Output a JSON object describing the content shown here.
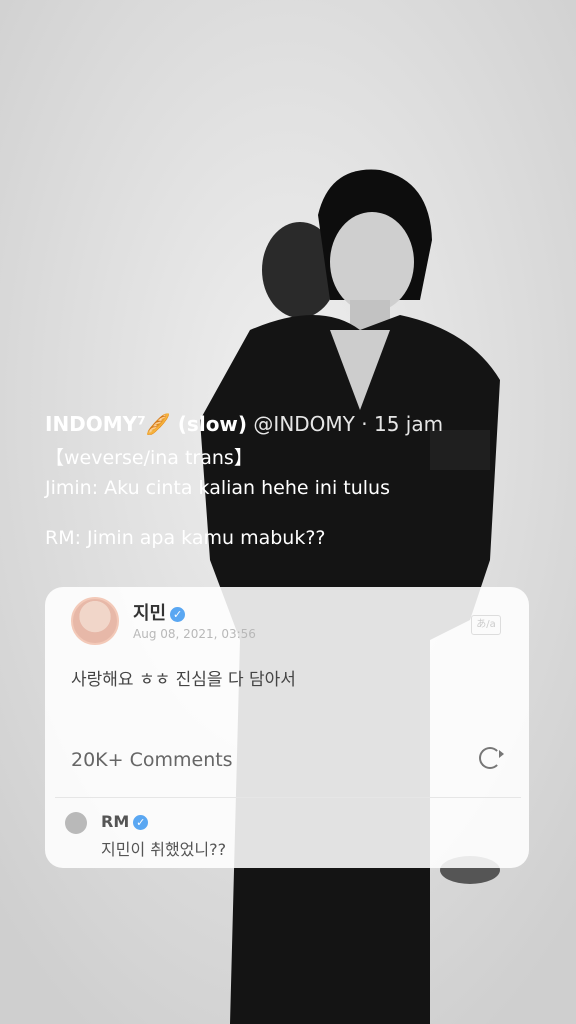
{
  "tweet": {
    "display_name": "INDOMY⁷🥖 (slow)",
    "handle": "@INDOMY",
    "time": "· 15 jam",
    "lines": [
      "【weverse/ina trans】",
      "Jimin: Aku cinta kalian hehe ini tulus",
      "RM: Jimin apa kamu mabuk??"
    ]
  },
  "card": {
    "author": "지민",
    "date": "Aug 08, 2021, 03:56",
    "text": "사랑해요 ㅎㅎ 진심을 다 담아서",
    "comments_count": "20K+ Comments",
    "translate_label": "あ/a",
    "comment": {
      "author": "RM",
      "text": "지민이 취했었니??"
    }
  },
  "colors": {
    "verified": "#5aa7f2",
    "text_white": "#ffffff"
  },
  "icons": [
    "more-icon",
    "verified-icon",
    "translate-icon",
    "refresh-icon"
  ]
}
